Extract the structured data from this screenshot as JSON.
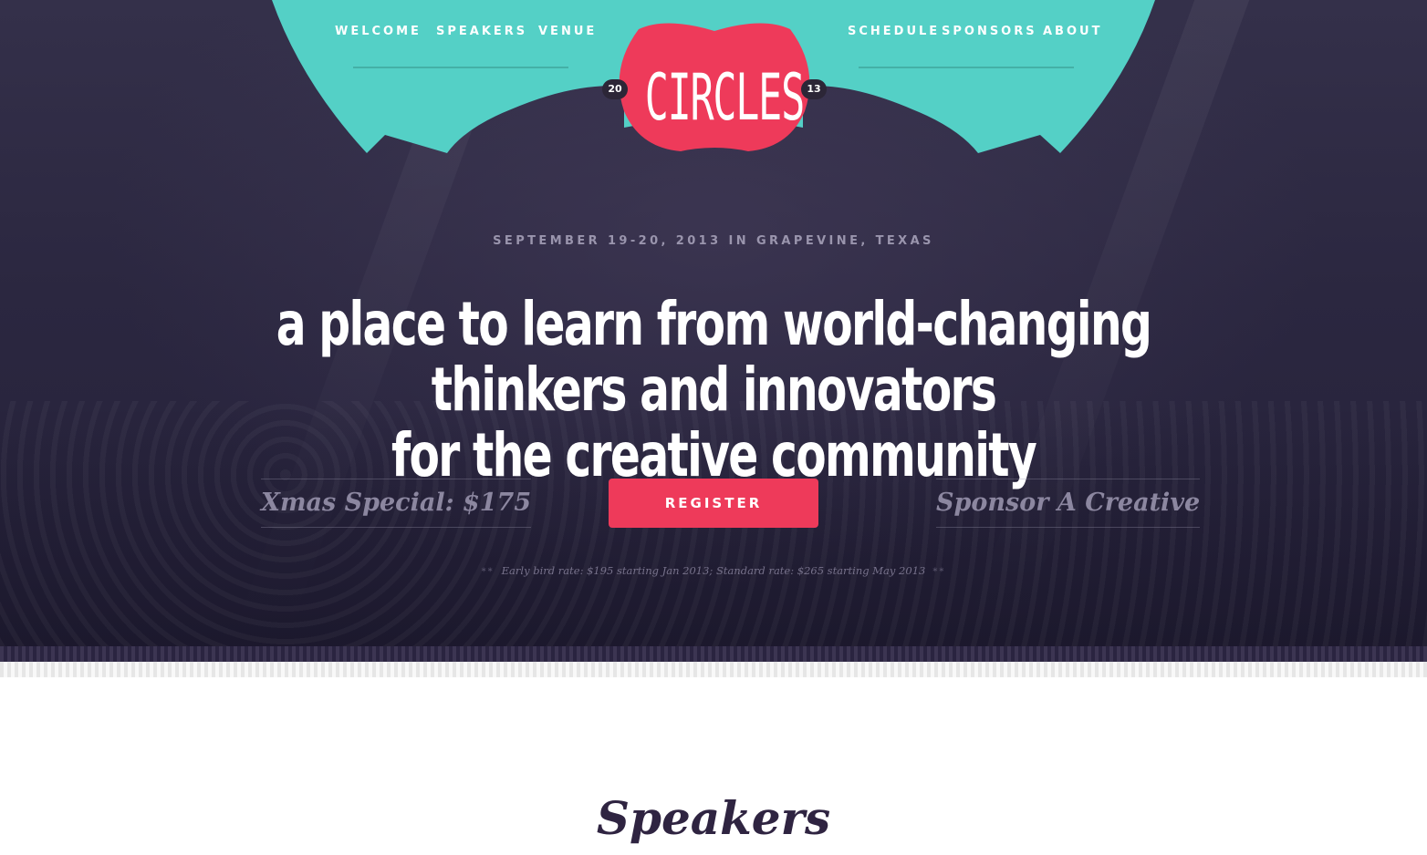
{
  "nav": {
    "left": [
      {
        "label": "WELCOME"
      },
      {
        "label": "SPEAKERS"
      },
      {
        "label": "VENUE"
      }
    ],
    "right": [
      {
        "label": "SCHEDULE"
      },
      {
        "label": "SPONSORS"
      },
      {
        "label": "ABOUT"
      }
    ]
  },
  "logo": {
    "name": "CIRCLES",
    "year_left": "20",
    "year_right": "13"
  },
  "hero": {
    "dateline": "SEPTEMBER 19-20, 2013 IN GRAPEVINE, TEXAS",
    "headline_line1": "a place to learn from world-changing thinkers and innovators",
    "headline_line2": "for the creative community",
    "special": "Xmas Special: $175",
    "register_label": "REGISTER",
    "sponsor_label": "Sponsor A Creative",
    "note": "Early bird rate: $195 starting Jan 2013; Standard rate: $265 starting May 2013",
    "note_ornament": "**"
  },
  "speakers": {
    "title": "Speakers"
  },
  "colors": {
    "teal": "#54d0c6",
    "pink": "#ee3a5a",
    "hero_bg": "#2b2740",
    "dark_text": "#2f2441"
  }
}
